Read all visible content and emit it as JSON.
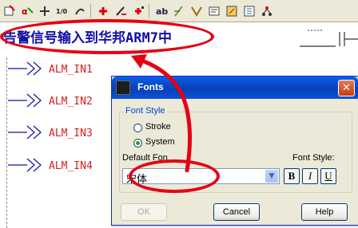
{
  "toolbar": {
    "icons": [
      "add-block-icon",
      "function-icon",
      "move-icon",
      "undo-icon",
      "redo-icon",
      "insert-icon",
      "pen-icon",
      "insert-right-icon",
      "format-icon",
      "label-icon",
      "wire-icon",
      "text-icon",
      "block-icon",
      "chart-icon",
      "network-icon"
    ]
  },
  "schematic": {
    "title": "告警信号输入到华邦ARM7中",
    "inputs": [
      "ALM_IN1",
      "ALM_IN2",
      "ALM_IN3",
      "ALM_IN4"
    ],
    "colors": {
      "title": "#1010a8",
      "signal": "#d42020",
      "annotation": "#e60014"
    }
  },
  "dialog": {
    "title": "Fonts",
    "group_label": "Font Style",
    "radio_stroke": "Stroke",
    "radio_system": "System",
    "default_font_label": "Default Fon",
    "font_style_label": "Font Style:",
    "font_value": "宋体",
    "bold_label": "B",
    "italic_label": "I",
    "underline_label": "U",
    "ok_label": "OK",
    "cancel_label": "Cancel",
    "help_label": "Help",
    "selected_style": "System"
  }
}
